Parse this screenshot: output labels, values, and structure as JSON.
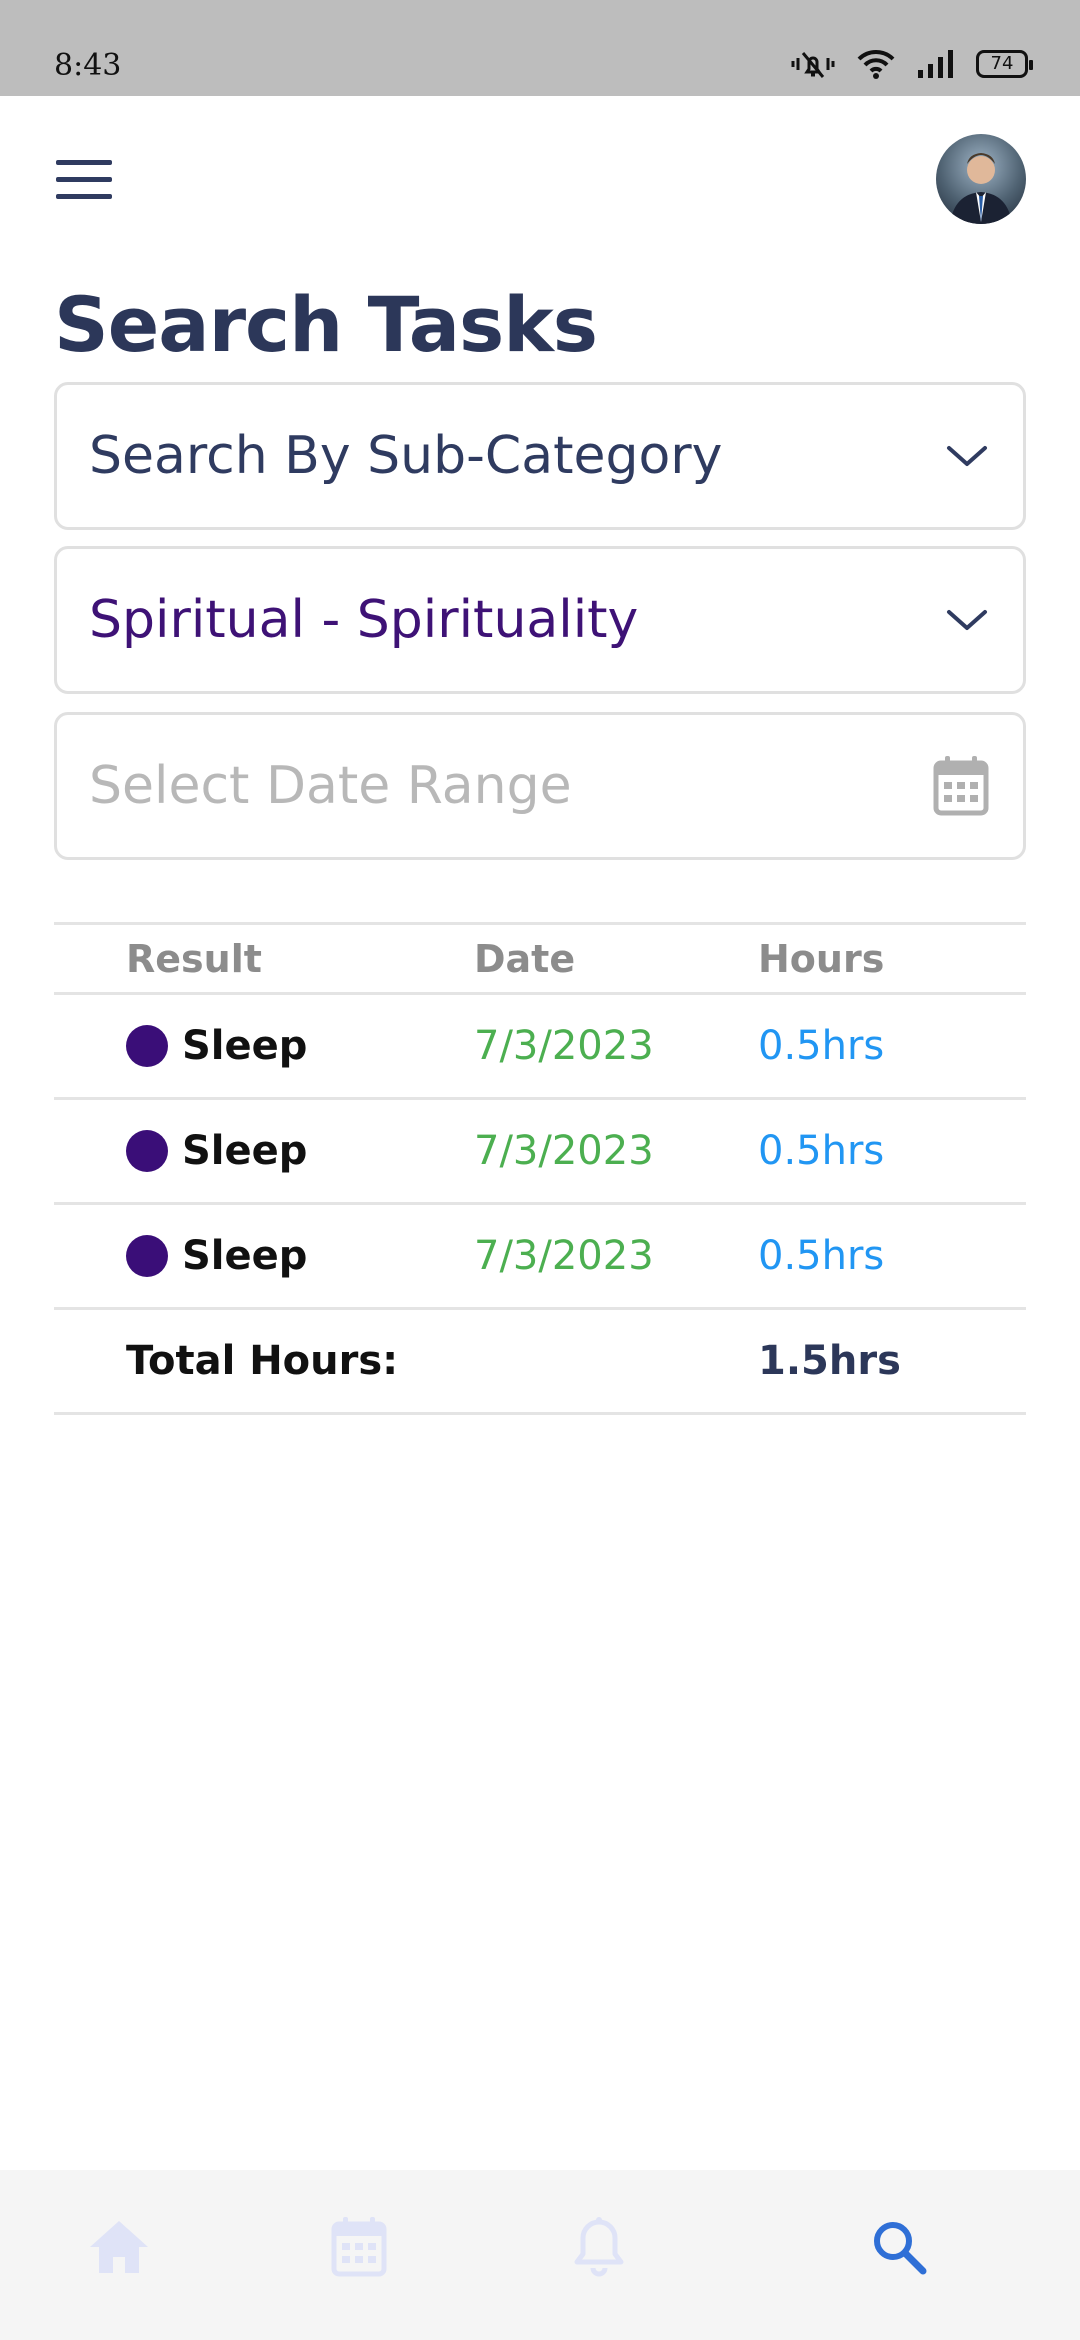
{
  "status_bar": {
    "time": "8:43",
    "battery": "74",
    "icons": [
      "mute-vibrate-icon",
      "wifi-icon",
      "signal-icon",
      "battery-icon"
    ]
  },
  "header": {
    "menu_icon": "hamburger-menu-icon",
    "avatar_icon": "user-avatar"
  },
  "page": {
    "title": "Search Tasks"
  },
  "filters": {
    "subcategory_select": {
      "value": "Search By Sub-Category",
      "icon": "chevron-down-icon"
    },
    "category_select": {
      "value": "Spiritual - Spirituality",
      "icon": "chevron-down-icon"
    },
    "date_range": {
      "placeholder": "Select Date Range",
      "icon": "calendar-icon"
    }
  },
  "table": {
    "columns": [
      "Result",
      "Date",
      "Hours"
    ],
    "rows": [
      {
        "result": "Sleep",
        "date": "7/3/2023",
        "hours": "0.5hrs"
      },
      {
        "result": "Sleep",
        "date": "7/3/2023",
        "hours": "0.5hrs"
      },
      {
        "result": "Sleep",
        "date": "7/3/2023",
        "hours": "0.5hrs"
      }
    ],
    "total_label": "Total Hours:",
    "total_value": "1.5hrs"
  },
  "bottom_nav": {
    "items": [
      "home-icon",
      "calendar-icon",
      "bell-icon",
      "search-icon"
    ],
    "active": "search-icon"
  },
  "colors": {
    "title": "#2c3759",
    "accent_purple": "#3a0e78",
    "date_green": "#4caf50",
    "hours_blue": "#2196f3",
    "nav_inactive": "#dfe3f7",
    "nav_active": "#2f6fd6"
  }
}
